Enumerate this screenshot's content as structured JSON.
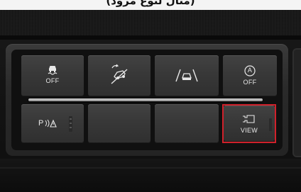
{
  "caption": {
    "text": "(مثال لنوع مزود)"
  },
  "buttons": {
    "traction_off": {
      "label": "OFF",
      "icon": "skid-car-icon"
    },
    "hill_descent": {
      "icon": "hill-descent-icon"
    },
    "lane_assist": {
      "icon": "lane-keep-icon"
    },
    "auto_stop_off": {
      "badge": "A",
      "label": "OFF",
      "icon": "auto-stop-icon"
    },
    "parking_sensor": {
      "label": "P",
      "icon": "parking-sensor-icon"
    },
    "blank_1": {},
    "blank_2": {},
    "camera_view": {
      "label": "VIEW",
      "icon": "camera-icon",
      "highlighted": true
    }
  },
  "colors": {
    "highlight": "#d0212b",
    "button_face": "#3a3a3a",
    "label": "#e8e8e8"
  }
}
